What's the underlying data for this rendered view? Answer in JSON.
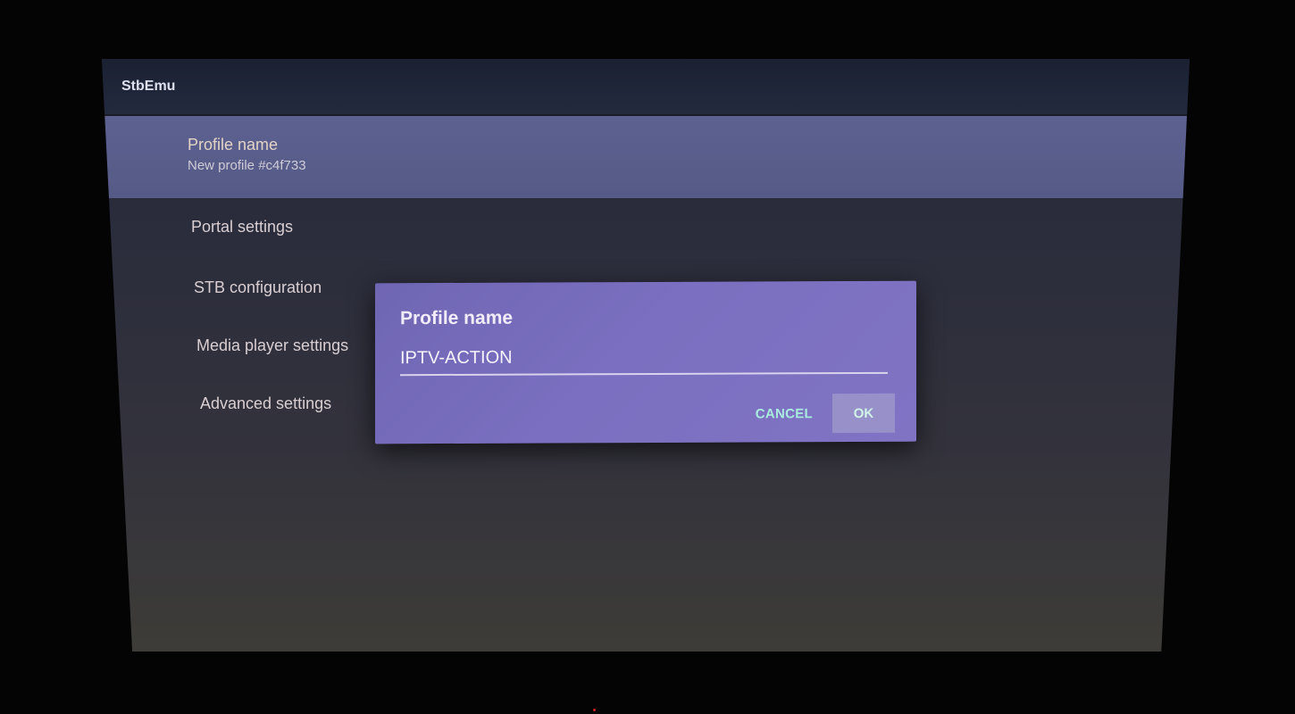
{
  "app": {
    "title": "StbEmu"
  },
  "settings_list": {
    "profile_item": {
      "title": "Profile name",
      "subtitle": "New profile #c4f733"
    },
    "items": [
      {
        "label": "Portal settings"
      },
      {
        "label": "STB configuration"
      },
      {
        "label": "Media player settings"
      },
      {
        "label": "Advanced settings"
      }
    ]
  },
  "dialog": {
    "title": "Profile name",
    "input_value": "IPTV-ACTION",
    "cancel_label": "CANCEL",
    "ok_label": "OK"
  },
  "colors": {
    "selected_item": "#5d6190",
    "dialog_bg": "#7a6fc0",
    "accent_button_text": "#a9ecdf"
  }
}
